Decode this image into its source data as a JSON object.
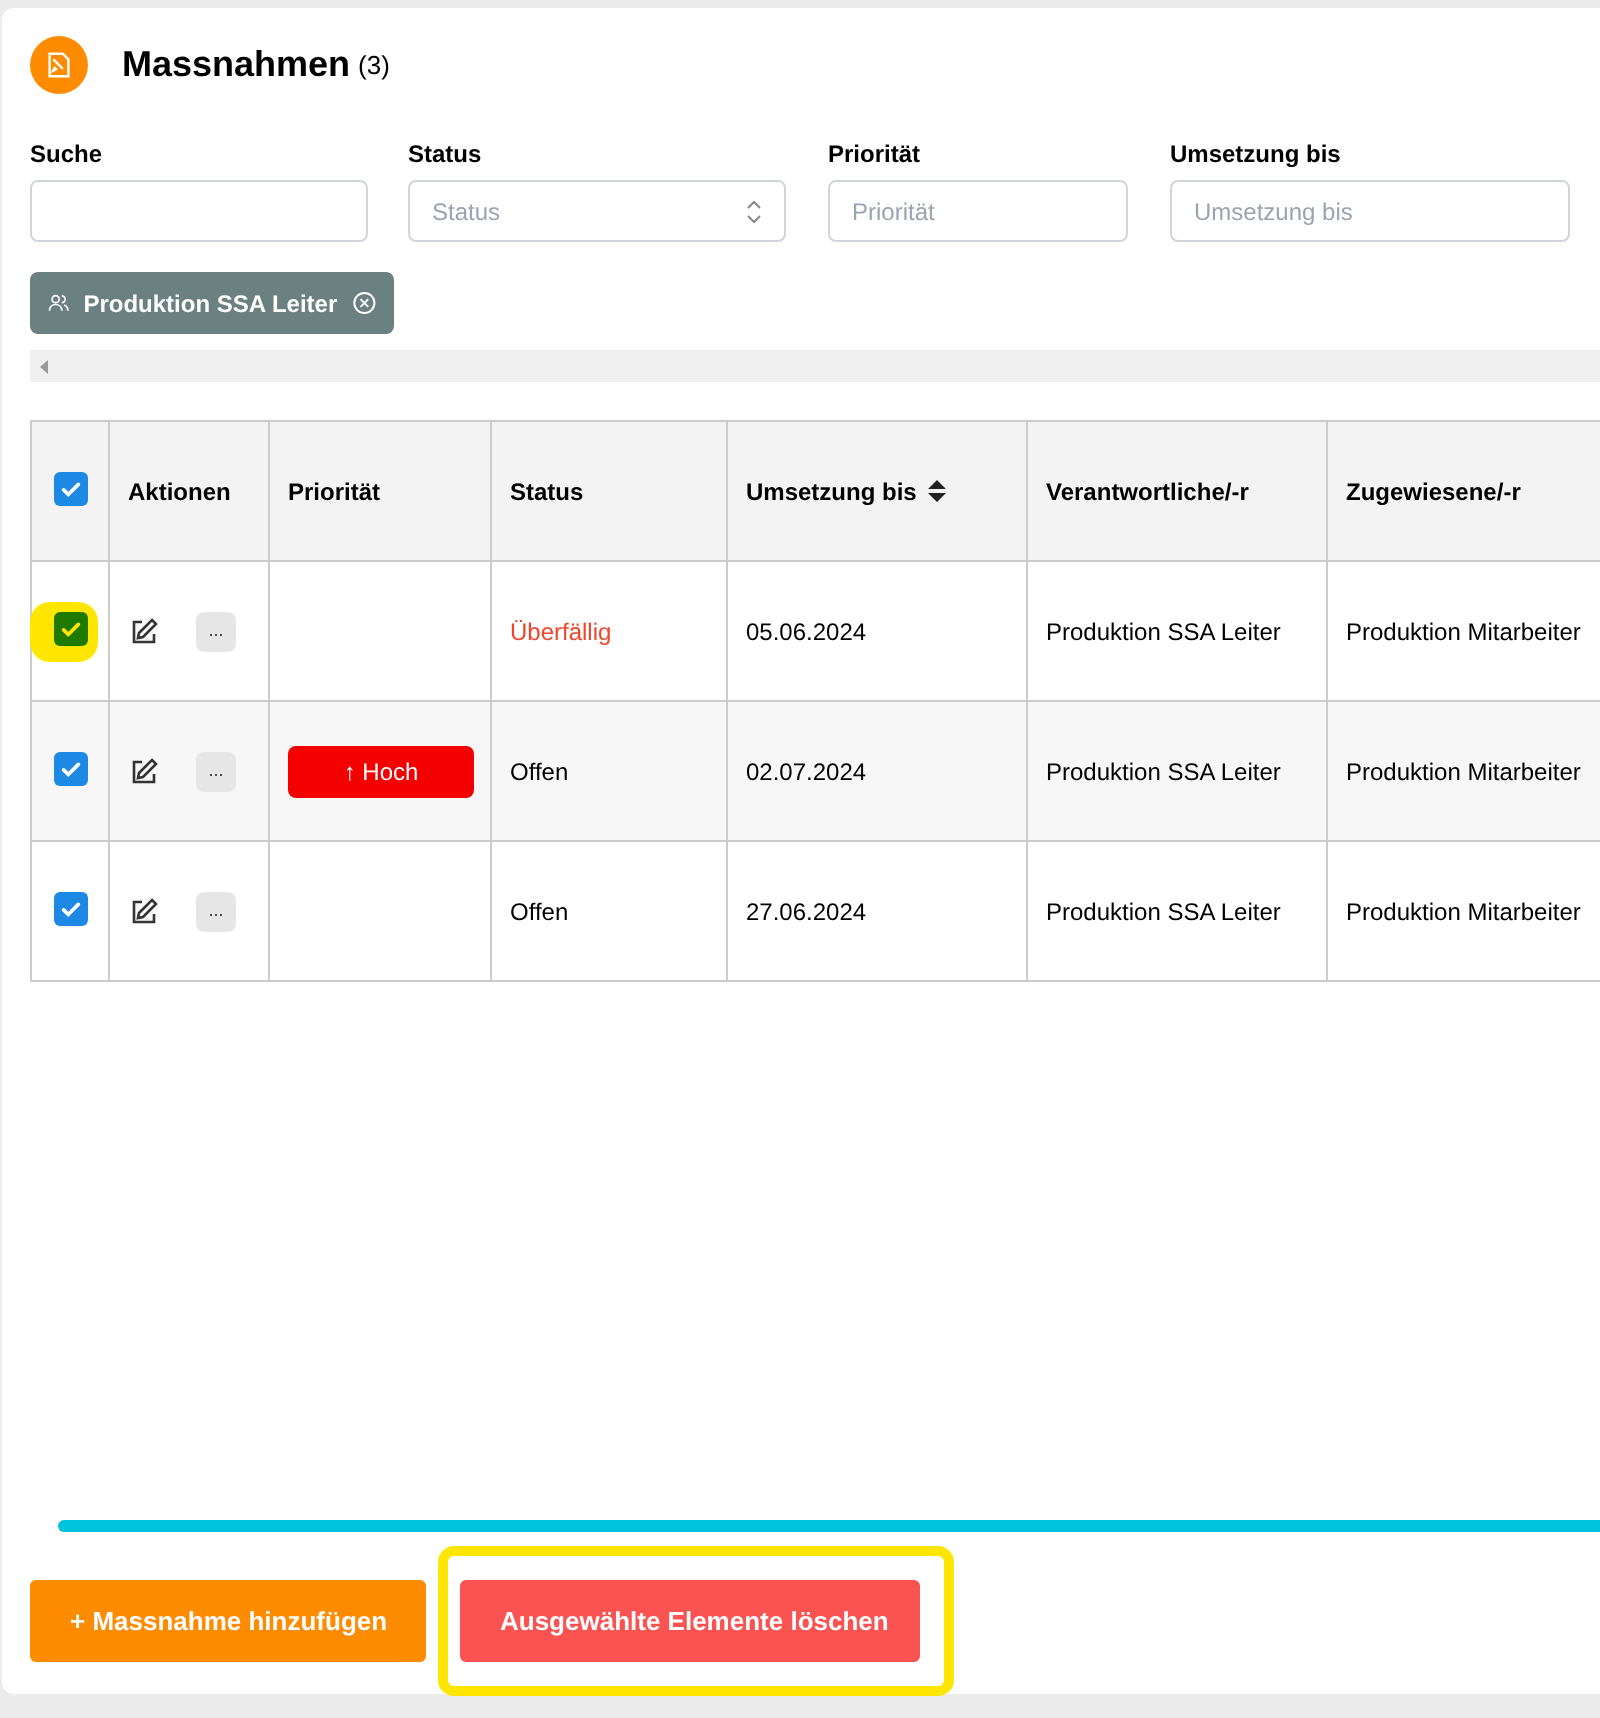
{
  "header": {
    "title": "Massnahmen",
    "count": "(3)"
  },
  "filters": [
    {
      "label": "Suche",
      "kind": "text"
    },
    {
      "label": "Status",
      "kind": "select",
      "placeholder": "Status"
    },
    {
      "label": "Priorität",
      "kind": "text",
      "placeholder": "Priorität"
    },
    {
      "label": "Umsetzung bis",
      "kind": "text",
      "placeholder": "Umsetzung bis"
    }
  ],
  "active_filter": {
    "label": "Produktion SSA Leiter"
  },
  "table": {
    "select_all": {
      "checked": true
    },
    "columns": [
      {
        "label": "Aktionen"
      },
      {
        "label": "Priorität"
      },
      {
        "label": "Status"
      },
      {
        "label": "Umsetzung bis",
        "sortable": true
      },
      {
        "label": "Verantwortliche/-r"
      },
      {
        "label": "Zugewiesene/-r"
      }
    ],
    "rows": [
      {
        "checked": true,
        "highlighted": true,
        "more": "...",
        "status": "Überfällig",
        "overdue": true,
        "due": "05.06.2024",
        "responsible": "Produktion SSA Leiter",
        "assignee": "Produktion Mitarbeiter"
      },
      {
        "checked": true,
        "highlighted": false,
        "more": "...",
        "priority": "↑ Hoch",
        "status": "Offen",
        "overdue": false,
        "due": "02.07.2024",
        "responsible": "Produktion SSA Leiter",
        "assignee": "Produktion Mitarbeiter"
      },
      {
        "checked": true,
        "highlighted": false,
        "more": "...",
        "status": "Offen",
        "overdue": false,
        "due": "27.06.2024",
        "responsible": "Produktion SSA Leiter",
        "assignee": "Produktion Mitarbeiter"
      }
    ]
  },
  "buttons": [
    {
      "label": "+ Massnahme hinzufügen",
      "kind": "add",
      "highlighted": false
    },
    {
      "label": "Ausgewählte Elemente löschen",
      "kind": "delete",
      "highlighted": true
    }
  ]
}
